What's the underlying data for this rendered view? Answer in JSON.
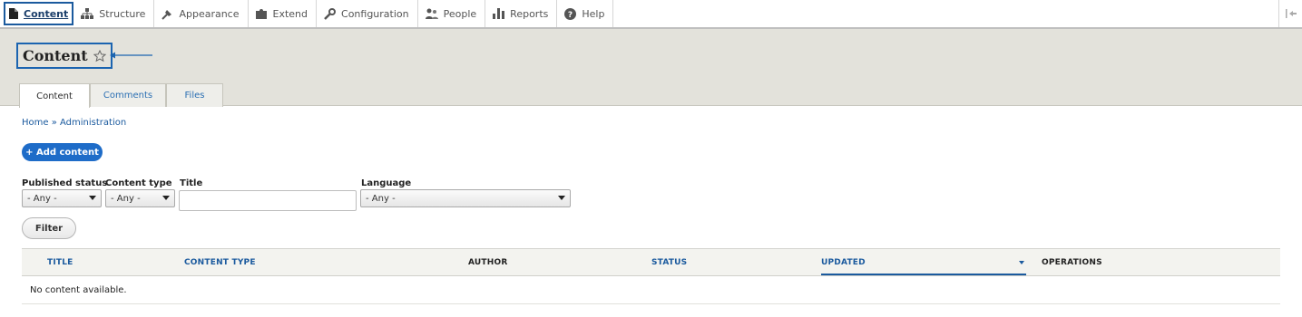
{
  "toolbar": {
    "items": [
      {
        "label": "Content",
        "icon": "content-icon"
      },
      {
        "label": "Structure",
        "icon": "structure-icon"
      },
      {
        "label": "Appearance",
        "icon": "appearance-icon"
      },
      {
        "label": "Extend",
        "icon": "extend-icon"
      },
      {
        "label": "Configuration",
        "icon": "configuration-icon"
      },
      {
        "label": "People",
        "icon": "people-icon"
      },
      {
        "label": "Reports",
        "icon": "reports-icon"
      },
      {
        "label": "Help",
        "icon": "help-icon"
      }
    ],
    "collapse_icon": "collapse-icon"
  },
  "header": {
    "title": "Content",
    "tabs": [
      {
        "label": "Content",
        "active": true
      },
      {
        "label": "Comments",
        "active": false
      },
      {
        "label": "Files",
        "active": false
      }
    ]
  },
  "breadcrumb": "Home » Administration",
  "add_button": "+ Add content",
  "filters": {
    "published_status": {
      "label": "Published status",
      "value": "- Any -"
    },
    "content_type": {
      "label": "Content type",
      "value": "- Any -"
    },
    "title": {
      "label": "Title",
      "value": ""
    },
    "language": {
      "label": "Language",
      "value": "- Any -"
    },
    "filter_button": "Filter"
  },
  "table": {
    "columns": [
      {
        "label": "TITLE",
        "sortable": true
      },
      {
        "label": "CONTENT TYPE",
        "sortable": true
      },
      {
        "label": "AUTHOR",
        "sortable": false
      },
      {
        "label": "STATUS",
        "sortable": true
      },
      {
        "label": "UPDATED",
        "sortable": true,
        "sorted": "desc"
      },
      {
        "label": "OPERATIONS",
        "sortable": false
      }
    ],
    "empty_message": "No content available."
  },
  "colors": {
    "accent": "#1b5a9e",
    "button_blue": "#1e6cc8",
    "header_bg": "#e3e2db"
  }
}
